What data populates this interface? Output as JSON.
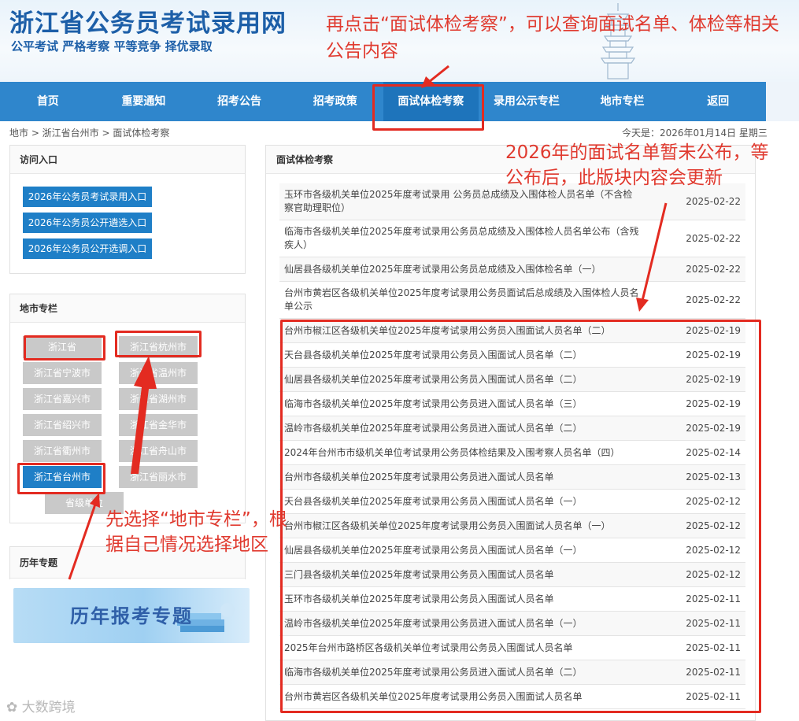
{
  "header": {
    "site_title": "浙江省公务员考试录用网",
    "slogan": "公平考试 严格考察 平等竞争 择优录取",
    "note": "再点击“面试体检考察”，可以查询面试名单、体检等相关公告内容"
  },
  "nav": {
    "items": [
      "首页",
      "重要通知",
      "招考公告",
      "招考政策",
      "面试体检考察",
      "录用公示专栏",
      "地市专栏",
      "返回"
    ],
    "active_index": 4
  },
  "breadcrumb": "地市 > 浙江省台州市 > 面试体检考察",
  "today": "今天是：2026年01月14日 星期三",
  "sidebar": {
    "access_title": "访问入口",
    "access_buttons": [
      "2026年公务员考试录用入口",
      "2026年公务员公开遴选入口",
      "2026年公务员公开选调入口"
    ],
    "city_title": "地市专栏",
    "cities_left": [
      "浙江省",
      "浙江省宁波市",
      "浙江省嘉兴市",
      "浙江省绍兴市",
      "浙江省衢州市",
      "浙江省台州市",
      "省级单位"
    ],
    "cities_right": [
      "浙江省杭州市",
      "浙江省温州市",
      "浙江省湖州市",
      "浙江省金华市",
      "浙江省舟山市",
      "浙江省丽水市"
    ],
    "selected_city": "浙江省台州市",
    "history_title": "历年专题",
    "banner_text": "历年报考专题"
  },
  "main": {
    "title": "面试体检考察",
    "rows": [
      {
        "title": "玉环市各级机关单位2025年度考试录用 公务员总成绩及入围体检人员名单（不含检察官助理职位）",
        "date": "2025-02-22"
      },
      {
        "title": "临海市各级机关单位2025年度考试录用公务员总成绩及入围体检人员名单公布（含残疾人）",
        "date": "2025-02-22"
      },
      {
        "title": "仙居县各级机关单位2025年度考试录用公务员总成绩及入围体检名单（一）",
        "date": "2025-02-22"
      },
      {
        "title": "台州市黄岩区各级机关单位2025年度考试录用公务员面试后总成绩及入围体检人员名单公示",
        "date": "2025-02-22"
      },
      {
        "title": "台州市椒江区各级机关单位2025年度考试录用公务员入围面试人员名单（二）",
        "date": "2025-02-19"
      },
      {
        "title": "天台县各级机关单位2025年度考试录用公务员入围面试人员名单（二）",
        "date": "2025-02-19"
      },
      {
        "title": "仙居县各级机关单位2025年度考试录用公务员入围面试人员名单（二）",
        "date": "2025-02-19"
      },
      {
        "title": "临海市各级机关单位2025年度考试录用公务员进入面试人员名单（三）",
        "date": "2025-02-19"
      },
      {
        "title": "温岭市各级机关单位2025年度考试录用公务员进入面试人员名单（二）",
        "date": "2025-02-19"
      },
      {
        "title": "2024年台州市市级机关单位考试录用公务员体检结果及入围考察人员名单（四）",
        "date": "2025-02-14"
      },
      {
        "title": "台州市各级机关单位2025年度考试录用公务员进入面试人员名单",
        "date": "2025-02-13"
      },
      {
        "title": "天台县各级机关单位2025年度考试录用公务员入围面试人员名单（一）",
        "date": "2025-02-12"
      },
      {
        "title": "台州市椒江区各级机关单位2025年度考试录用公务员入围面试人员名单（一）",
        "date": "2025-02-12"
      },
      {
        "title": "仙居县各级机关单位2025年度考试录用公务员入围面试人员名单（一）",
        "date": "2025-02-12"
      },
      {
        "title": "三门县各级机关单位2025年度考试录用公务员入围面试人员名单",
        "date": "2025-02-12"
      },
      {
        "title": "玉环市各级机关单位2025年度考试录用公务员入围面试人员名单",
        "date": "2025-02-11"
      },
      {
        "title": "温岭市各级机关单位2025年度考试录用公务员进入面试人员名单（一）",
        "date": "2025-02-11"
      },
      {
        "title": "2025年台州市路桥区各级机关单位考试录用公务员入围面试人员名单",
        "date": "2025-02-11"
      },
      {
        "title": "临海市各级机关单位2025年度考试录用公务员进入面试人员名单（二）",
        "date": "2025-02-11"
      },
      {
        "title": "台州市黄岩区各级机关单位2025年度考试录用公务员入围面试人员名单",
        "date": "2025-02-11"
      }
    ]
  },
  "annotations": {
    "right_note": "2026年的面试名单暂未公布，等公布后，此版块内容会更新",
    "left_note": "先选择“地市专栏”，根据自己情况选择地区",
    "watermark": "大数跨境",
    "accent_red": "#e32b21",
    "nav_blue": "#2f86cc"
  }
}
